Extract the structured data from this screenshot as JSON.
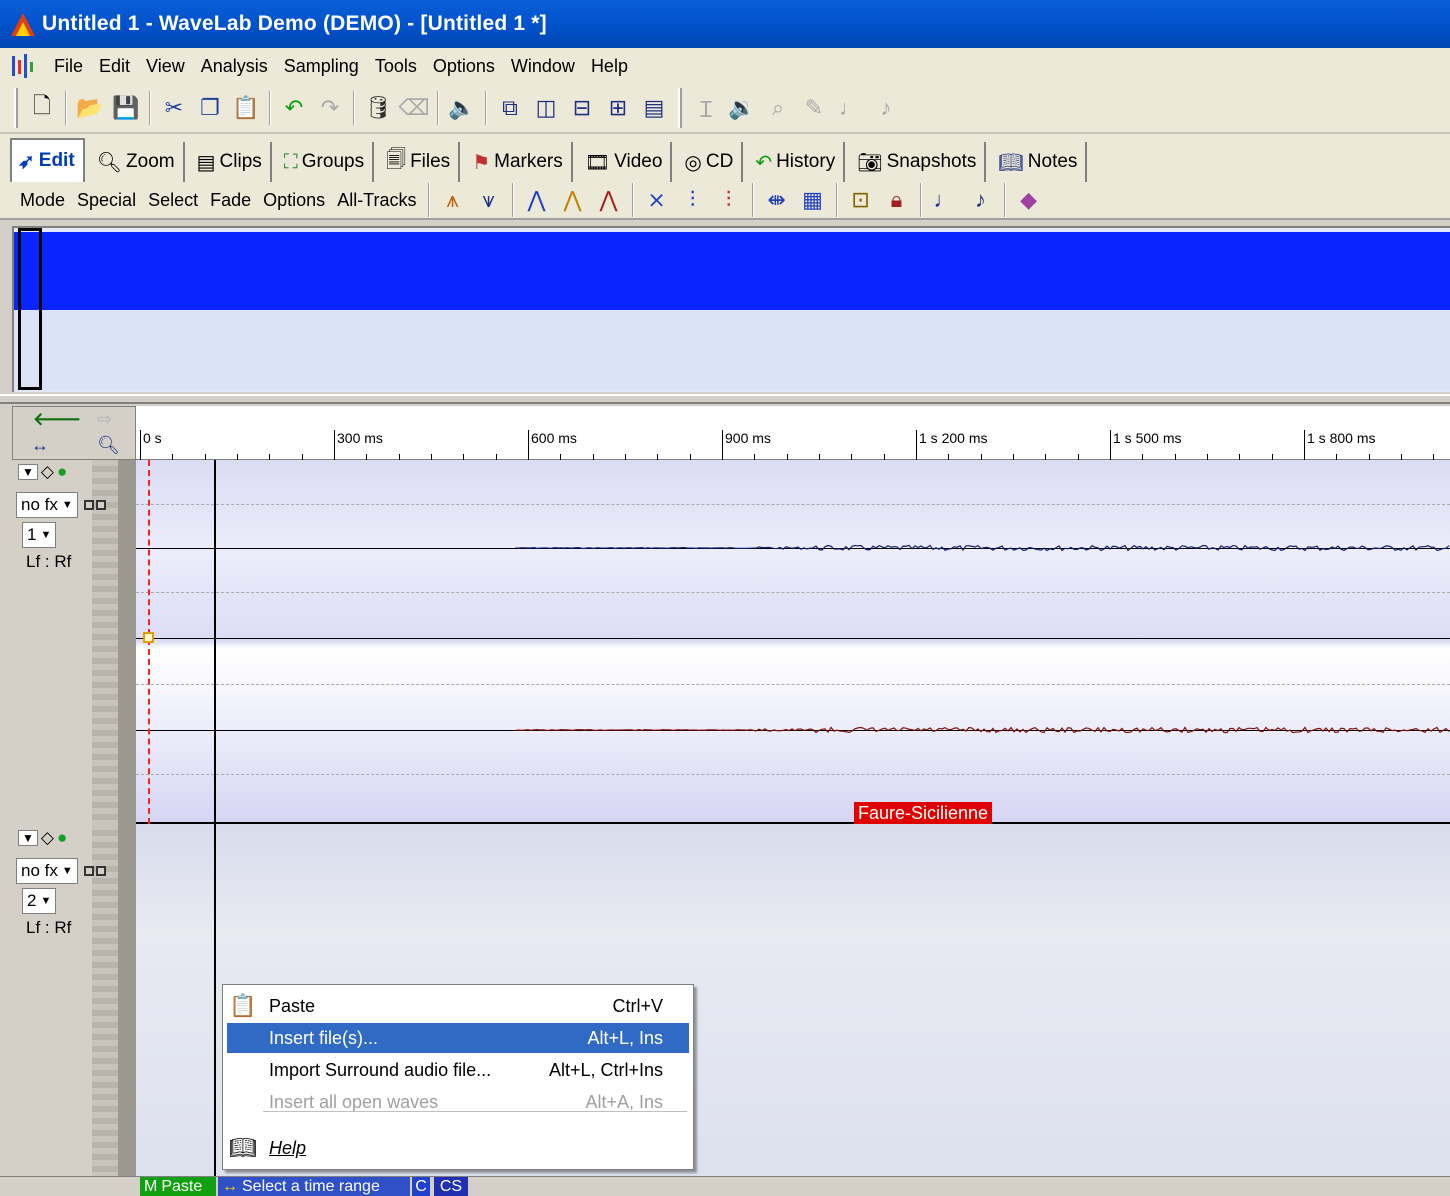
{
  "window": {
    "title": "Untitled 1 - WaveLab Demo (DEMO) - [Untitled 1 *]"
  },
  "menu": [
    "File",
    "Edit",
    "View",
    "Analysis",
    "Sampling",
    "Tools",
    "Options",
    "Window",
    "Help"
  ],
  "tabs": [
    {
      "label": "Edit",
      "icon": "edit-icon"
    },
    {
      "label": "Zoom",
      "icon": "magnifier-icon"
    },
    {
      "label": "Clips",
      "icon": "clips-icon"
    },
    {
      "label": "Groups",
      "icon": "groups-icon"
    },
    {
      "label": "Files",
      "icon": "files-icon"
    },
    {
      "label": "Markers",
      "icon": "markers-icon"
    },
    {
      "label": "Video",
      "icon": "video-icon"
    },
    {
      "label": "CD",
      "icon": "cd-icon"
    },
    {
      "label": "History",
      "icon": "history-icon"
    },
    {
      "label": "Snapshots",
      "icon": "camera-icon"
    },
    {
      "label": "Notes",
      "icon": "notes-icon"
    }
  ],
  "edit_menu": [
    "Mode",
    "Special",
    "Select",
    "Fade",
    "Options",
    "All-Tracks"
  ],
  "ruler": {
    "labels": [
      "0 s",
      "300 ms",
      "600 ms",
      "900 ms",
      "1 s 200 ms",
      "1 s 500 ms",
      "1 s 800 ms"
    ]
  },
  "tracks": [
    {
      "fx": "no fx",
      "number": "1",
      "routing": "Lf : Rf",
      "clip": "Faure-Sicilienne"
    },
    {
      "fx": "no fx",
      "number": "2",
      "routing": "Lf : Rf"
    }
  ],
  "context_menu": {
    "items": [
      {
        "label": "Paste",
        "shortcut": "Ctrl+V",
        "icon": "paste-icon",
        "state": "normal"
      },
      {
        "label": "Insert file(s)...",
        "shortcut": "Alt+L, Ins",
        "state": "highlighted"
      },
      {
        "label": "Import Surround audio file...",
        "shortcut": "Alt+L, Ctrl+Ins",
        "state": "normal"
      },
      {
        "label": "Insert all open waves",
        "shortcut": "Alt+A, Ins",
        "state": "disabled"
      },
      {
        "label": "Help",
        "shortcut": "",
        "icon": "help-book-icon",
        "state": "normal"
      }
    ]
  },
  "status": {
    "mode_letter": "M",
    "mode_text": "Paste",
    "hint": "Select a time range",
    "extra_c": "C",
    "extra_cs": "CS"
  },
  "colors": {
    "title_bar": "#0050c8",
    "overview_band": "#0a24ff",
    "clip_label": "#e00000",
    "menu_highlight": "#316ac5"
  }
}
